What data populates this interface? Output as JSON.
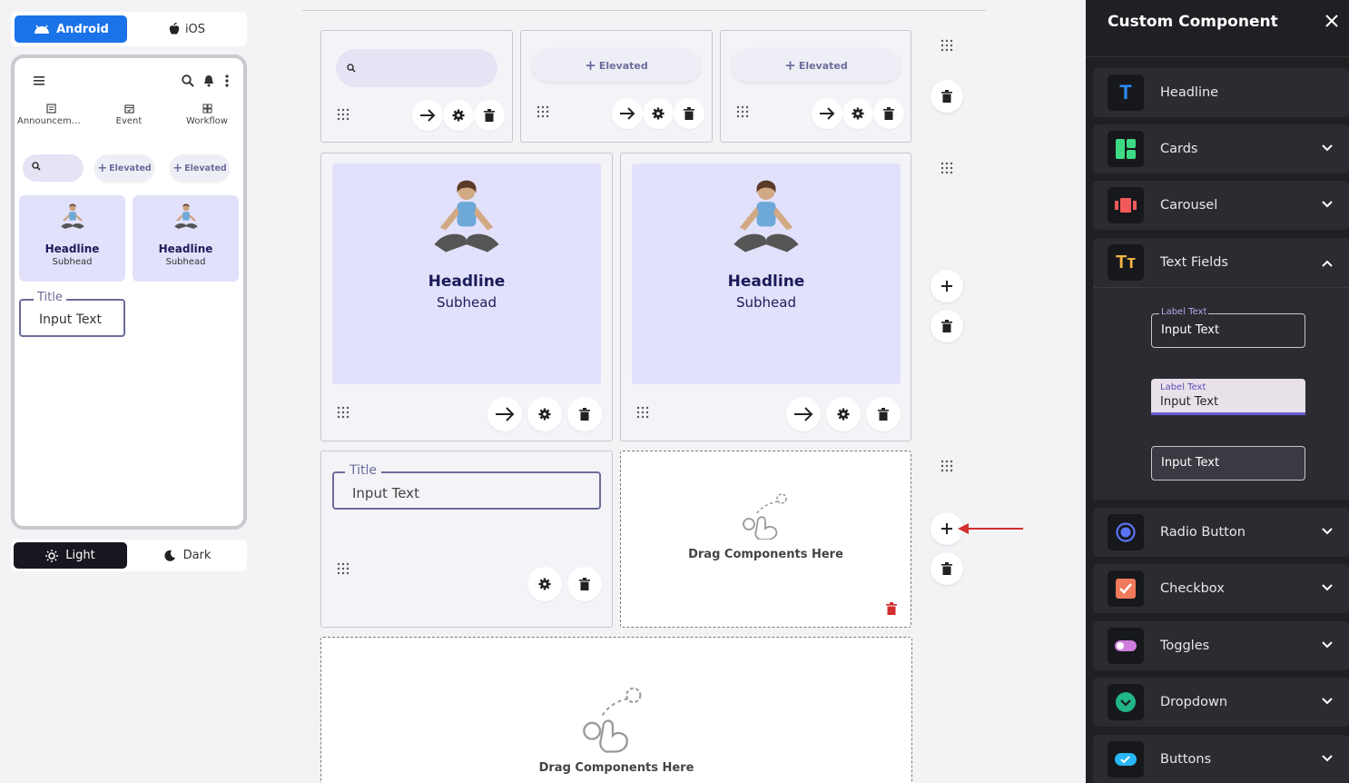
{
  "platform": {
    "android": "Android",
    "ios": "iOS"
  },
  "phone": {
    "tabs": [
      {
        "label": "Announceme...",
        "icon": "document-icon"
      },
      {
        "label": "Event",
        "icon": "calendar-icon"
      },
      {
        "label": "Workflow",
        "icon": "grid-icon"
      }
    ],
    "elevated_label": "Elevated",
    "cards": [
      {
        "headline": "Headline",
        "subhead": "Subhead"
      },
      {
        "headline": "Headline",
        "subhead": "Subhead"
      }
    ],
    "field": {
      "label": "Title",
      "value": "Input Text"
    }
  },
  "theme": {
    "light": "Light",
    "dark": "Dark"
  },
  "canvas": {
    "elevated_label": "Elevated",
    "cards": [
      {
        "headline": "Headline",
        "subhead": "Subhead"
      },
      {
        "headline": "Headline",
        "subhead": "Subhead"
      }
    ],
    "field": {
      "label": "Title",
      "value": "Input Text"
    },
    "drop_zone_label": "Drag Components Here"
  },
  "sidebar": {
    "title": "Custom Component",
    "items": [
      {
        "label": "Headline",
        "icon": "headline-icon",
        "color": "#2e8bff"
      },
      {
        "label": "Cards",
        "icon": "cards-icon",
        "color": "#3ddc84"
      },
      {
        "label": "Carousel",
        "icon": "carousel-icon",
        "color": "#f25a5a"
      },
      {
        "label": "Text Fields",
        "icon": "text-fields-icon",
        "color": "#f5b544"
      },
      {
        "label": "Radio Button",
        "icon": "radio-icon",
        "color": "#5b74f5"
      },
      {
        "label": "Checkbox",
        "icon": "checkbox-icon",
        "color": "#f07a5c"
      },
      {
        "label": "Toggles",
        "icon": "toggle-icon",
        "color": "#d07de0"
      },
      {
        "label": "Dropdown",
        "icon": "dropdown-icon",
        "color": "#21b58a"
      },
      {
        "label": "Buttons",
        "icon": "buttons-icon",
        "color": "#29b6f6"
      }
    ],
    "text_field_variants": [
      {
        "label": "Label Text",
        "value": "Input Text"
      },
      {
        "label": "Label Text",
        "value": "Input Text"
      },
      {
        "value": "Input Text"
      }
    ]
  },
  "colors": {
    "accent": "#1a73e8",
    "card_bg": "#e2e1fb",
    "outline": "#6b6c99",
    "delete_red": "#d32f2f"
  }
}
